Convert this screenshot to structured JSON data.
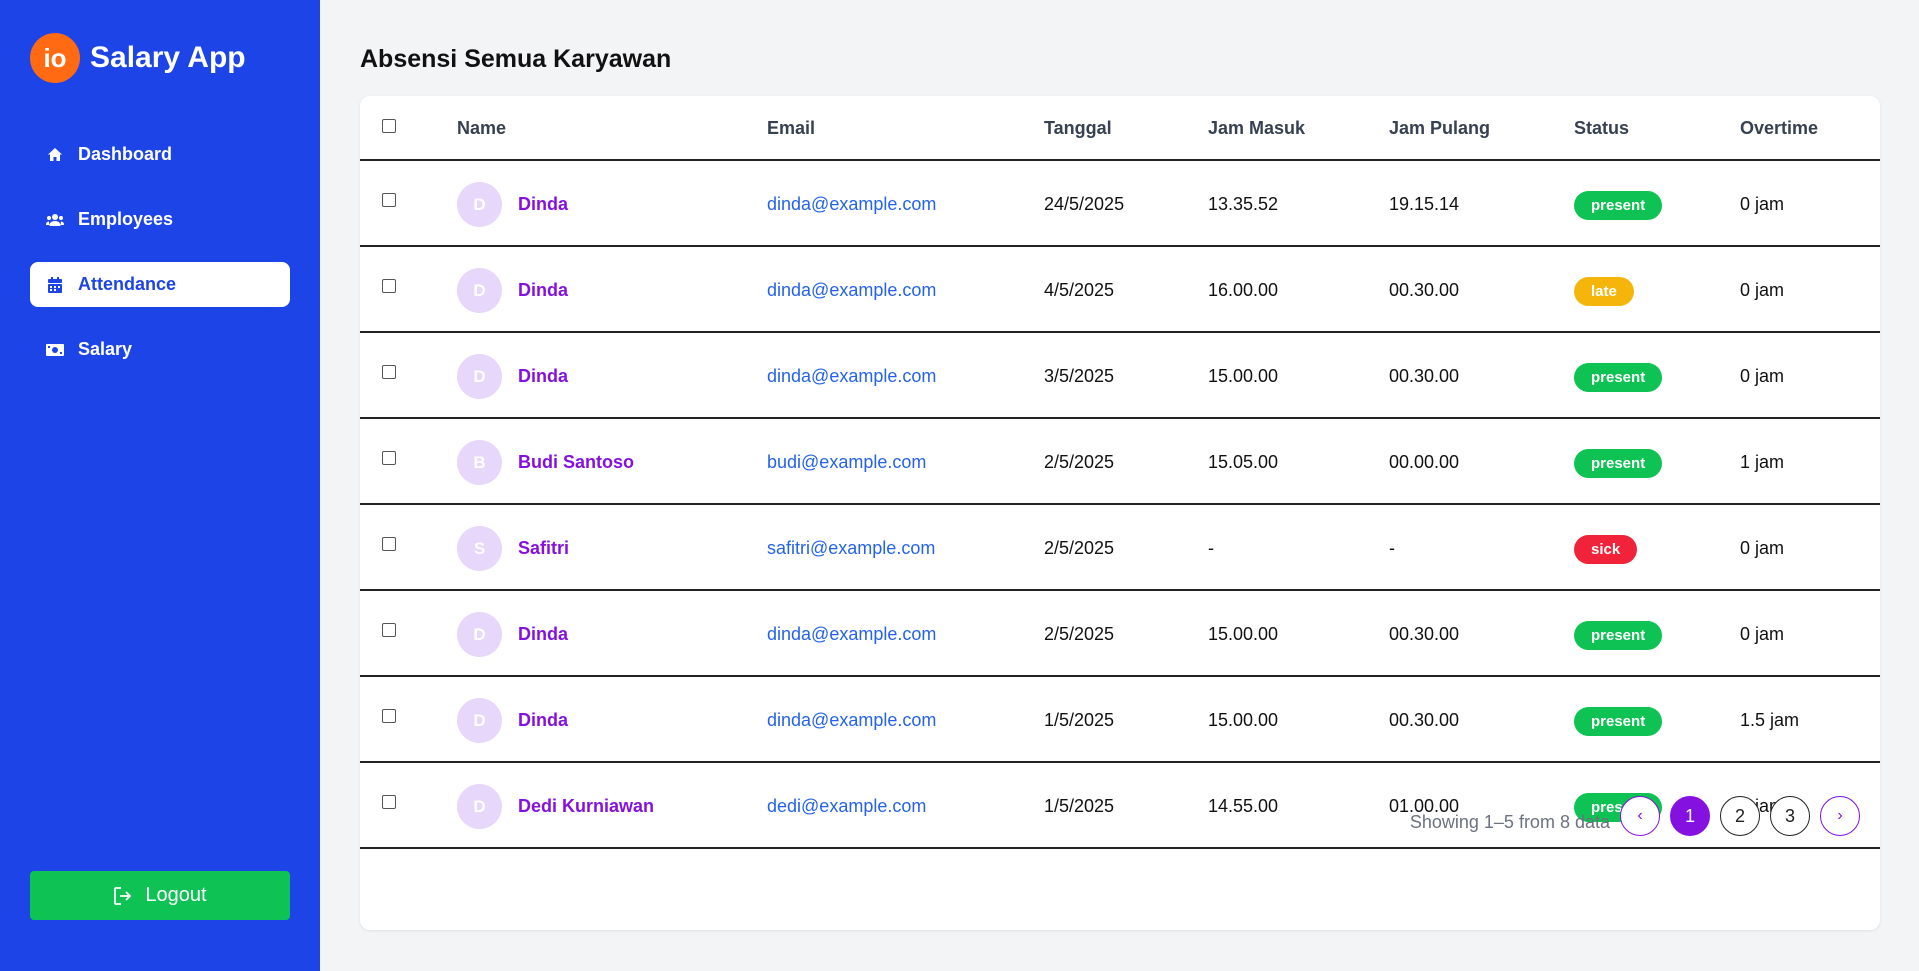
{
  "sidebar": {
    "logo_text": "io",
    "app_title": "Salary App",
    "items": [
      {
        "label": "Dashboard",
        "icon": "home-icon"
      },
      {
        "label": "Employees",
        "icon": "users-icon"
      },
      {
        "label": "Attendance",
        "icon": "calendar-icon",
        "active": true
      },
      {
        "label": "Salary",
        "icon": "money-icon"
      }
    ],
    "logout_label": "Logout"
  },
  "page": {
    "title": "Absensi Semua Karyawan"
  },
  "table": {
    "headers": {
      "name": "Name",
      "email": "Email",
      "tanggal": "Tanggal",
      "jam_masuk": "Jam Masuk",
      "jam_pulang": "Jam Pulang",
      "status": "Status",
      "overtime": "Overtime"
    },
    "rows": [
      {
        "initial": "D",
        "name": "Dinda",
        "email": "dinda@example.com",
        "tanggal": "24/5/2025",
        "jam_masuk": "13.35.52",
        "jam_pulang": "19.15.14",
        "status": "present",
        "overtime": "0 jam"
      },
      {
        "initial": "D",
        "name": "Dinda",
        "email": "dinda@example.com",
        "tanggal": "4/5/2025",
        "jam_masuk": "16.00.00",
        "jam_pulang": "00.30.00",
        "status": "late",
        "overtime": "0 jam"
      },
      {
        "initial": "D",
        "name": "Dinda",
        "email": "dinda@example.com",
        "tanggal": "3/5/2025",
        "jam_masuk": "15.00.00",
        "jam_pulang": "00.30.00",
        "status": "present",
        "overtime": "0 jam"
      },
      {
        "initial": "B",
        "name": "Budi Santoso",
        "email": "budi@example.com",
        "tanggal": "2/5/2025",
        "jam_masuk": "15.05.00",
        "jam_pulang": "00.00.00",
        "status": "present",
        "overtime": "1 jam"
      },
      {
        "initial": "S",
        "name": "Safitri",
        "email": "safitri@example.com",
        "tanggal": "2/5/2025",
        "jam_masuk": "-",
        "jam_pulang": "-",
        "status": "sick",
        "overtime": "0 jam"
      },
      {
        "initial": "D",
        "name": "Dinda",
        "email": "dinda@example.com",
        "tanggal": "2/5/2025",
        "jam_masuk": "15.00.00",
        "jam_pulang": "00.30.00",
        "status": "present",
        "overtime": "0 jam"
      },
      {
        "initial": "D",
        "name": "Dinda",
        "email": "dinda@example.com",
        "tanggal": "1/5/2025",
        "jam_masuk": "15.00.00",
        "jam_pulang": "00.30.00",
        "status": "present",
        "overtime": "1.5 jam"
      },
      {
        "initial": "D",
        "name": "Dedi Kurniawan",
        "email": "dedi@example.com",
        "tanggal": "1/5/2025",
        "jam_masuk": "14.55.00",
        "jam_pulang": "01.00.00",
        "status": "present",
        "overtime": "2 jam"
      }
    ]
  },
  "pagination": {
    "showing_text": "Showing 1–5 from 8 data",
    "prev": "‹",
    "next": "›",
    "pages": [
      "1",
      "2",
      "3"
    ],
    "current": "1"
  },
  "colors": {
    "sidebar_bg": "#1d44e6",
    "accent_purple": "#8511e0",
    "present": "#0ec253",
    "late": "#f5b50a",
    "sick": "#f0233a",
    "logo": "#ff6a13"
  }
}
